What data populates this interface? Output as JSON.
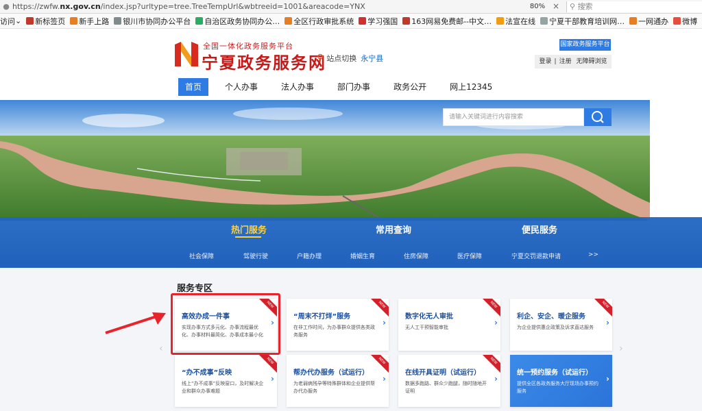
{
  "browser": {
    "url_prefix": "https://zwfw.",
    "url_domain": "nx.gov.cn",
    "url_suffix": "/index.jsp?urltype=tree.TreeTempUrl&wbtreeid=1001&areacode=YNX",
    "zoom": "80%",
    "close": "×",
    "search_placeholder": "搜索",
    "bookmarks": [
      {
        "label": "访问",
        "color": "#ffffff",
        "arrow": "⌄"
      },
      {
        "label": "新标签页",
        "color": "#c0392b"
      },
      {
        "label": "新手上路",
        "color": "#e67e22"
      },
      {
        "label": "银川市协同办公平台",
        "color": "#7f8c8d"
      },
      {
        "label": "自治区政务协同办公…",
        "color": "#27ae60"
      },
      {
        "label": "全区行政审批系统",
        "color": "#e67e22"
      },
      {
        "label": "学习强国",
        "color": "#d32f2f"
      },
      {
        "label": "163网易免费邮--中文…",
        "color": "#c0392b"
      },
      {
        "label": "法宣在线",
        "color": "#f39c12"
      },
      {
        "label": "宁夏干部教育培训网…",
        "color": "#95a5a6"
      },
      {
        "label": "一网通办",
        "color": "#e67e22"
      },
      {
        "label": "微博",
        "color": "#e74c3c"
      }
    ]
  },
  "header": {
    "logo_subtitle": "全国一体化政务服务平台",
    "logo_title": "宁夏政务服务网",
    "station_switch": "站点切换",
    "station_city": "永宁县",
    "national_platform": "国家政务服务平台",
    "login": "登录",
    "register": "注册",
    "accessible": "无障碍浏览",
    "separator": "|"
  },
  "nav": {
    "items": [
      "首页",
      "个人办事",
      "法人办事",
      "部门办事",
      "政务公开",
      "网上12345"
    ]
  },
  "search": {
    "placeholder": "请输入关键词进行内容搜索"
  },
  "service_bar": {
    "tabs": [
      "热门服务",
      "常用查询",
      "便民服务"
    ],
    "links": [
      "社会保障",
      "驾驶行驶",
      "户籍办理",
      "婚姻生育",
      "住房保障",
      "医疗保障",
      "宁夏交罚退款申请",
      ">>"
    ]
  },
  "zone": {
    "title": "服务专区",
    "arrow_left": "‹",
    "arrow_right": "›",
    "ribbon_text": "NEW",
    "chevron": "›",
    "cards": [
      {
        "title": "高效办成一件事",
        "desc": "实现办事方式多元化、办事流程最优化、办事材料最简化、办事成本最小化"
      },
      {
        "title": "“周末不打烊”服务",
        "desc": "在非工作时间，为办事群众提供各类政务服务"
      },
      {
        "title": "数字化无人审批",
        "desc": "无人工干预智能审批"
      },
      {
        "title": "利企、安企、暖企服务",
        "desc": "为企业提供惠企政策及诉求直达服务"
      },
      {
        "title": "“办不成事”反映",
        "desc": "线上“办不成事”反映窗口，及时解决企业和群众办事难题"
      },
      {
        "title": "帮办代办服务（试运行）",
        "desc": "为老弱病残孕等特殊群体和企业提供帮办代办服务"
      },
      {
        "title": "在线开具证明（试运行）",
        "desc": "数据多跑路、群众少跑腿，随时随地开证明"
      },
      {
        "title": "统一预约服务（试运行）",
        "desc": "提供全区各政务服务大厅现场办事预约服务"
      }
    ]
  },
  "colors": {
    "brand_red": "#c41a1a",
    "brand_blue": "#2d7be3",
    "highlight_red": "#e8232b",
    "accent_yellow": "#ffd33d"
  }
}
